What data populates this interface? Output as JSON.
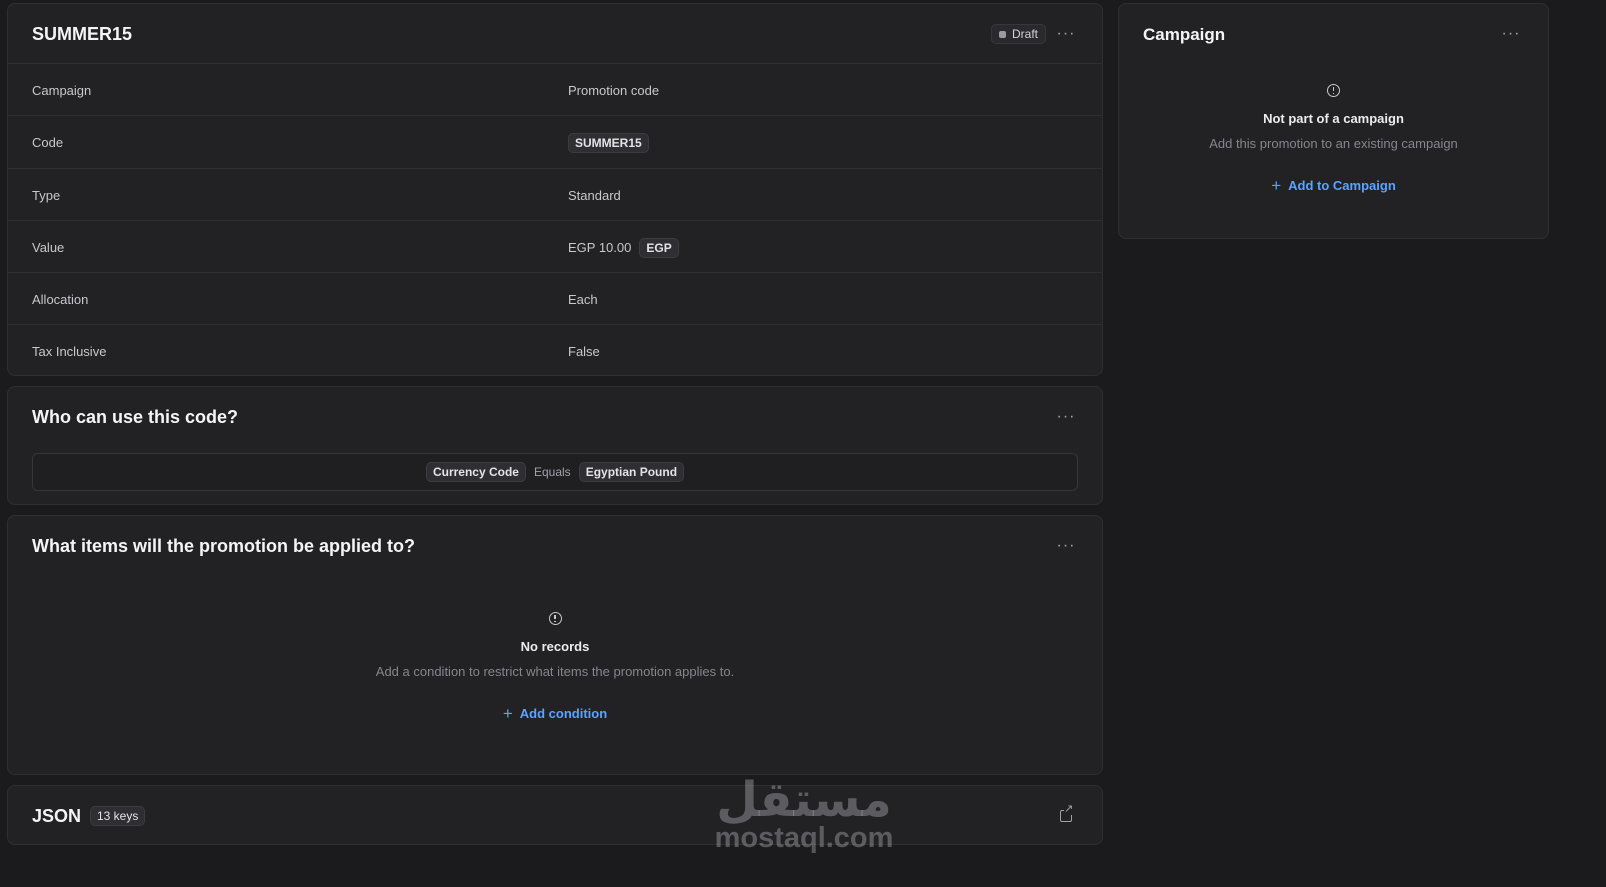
{
  "promotion": {
    "title": "SUMMER15",
    "status": "Draft",
    "rows": [
      {
        "key": "Campaign",
        "value": "Promotion code"
      },
      {
        "key": "Code",
        "value": "SUMMER15"
      },
      {
        "key": "Type",
        "value": "Standard"
      },
      {
        "key": "Value",
        "value": "EGP 10.00",
        "badge": "EGP"
      },
      {
        "key": "Allocation",
        "value": "Each"
      },
      {
        "key": "Tax Inclusive",
        "value": "False"
      }
    ]
  },
  "who": {
    "title": "Who can use this code?",
    "rule": {
      "attribute": "Currency Code",
      "operator": "Equals",
      "value": "Egyptian Pound"
    }
  },
  "items": {
    "title": "What items will the promotion be applied to?",
    "empty_title": "No records",
    "empty_desc": "Add a condition to restrict what items the promotion applies to.",
    "add_label": "Add condition"
  },
  "json": {
    "title": "JSON",
    "keys_badge": "13 keys"
  },
  "campaign": {
    "title": "Campaign",
    "empty_title": "Not part of a campaign",
    "empty_desc": "Add this promotion to an existing campaign",
    "add_label": "Add to Campaign"
  },
  "watermark": {
    "arabic": "مستقل",
    "latin": "mostaql.com"
  },
  "icons": {
    "menu": "more-horizontal-icon",
    "empty": "exclamation-circle-icon",
    "add": "plus-icon",
    "open": "external-link-icon"
  }
}
